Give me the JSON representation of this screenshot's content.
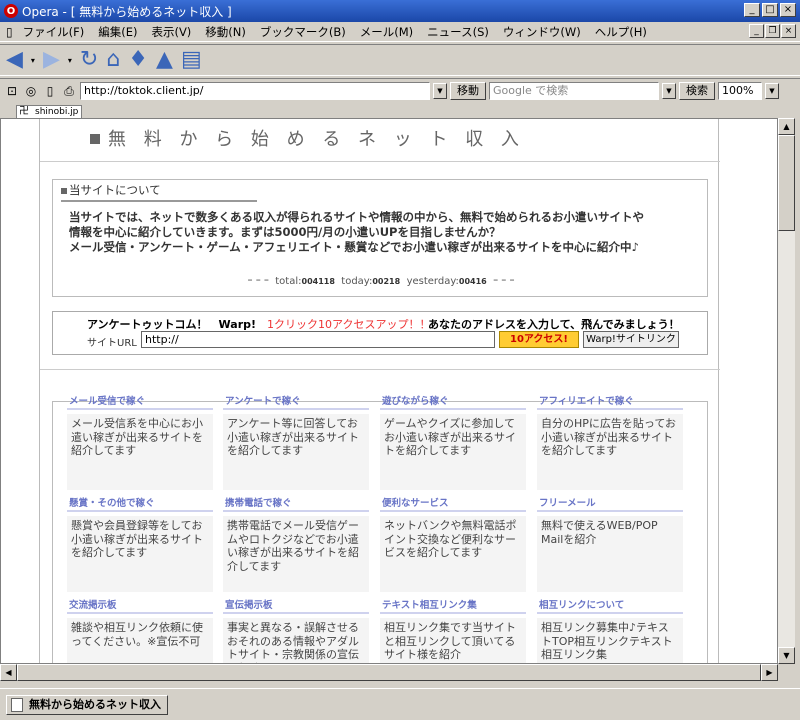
{
  "window": {
    "title": "Opera - [ 無料から始めるネット収入 ]",
    "app_icon": "O",
    "min": "_",
    "max": "□",
    "close": "×"
  },
  "menu": [
    "ファイル(F)",
    "編集(E)",
    "表示(V)",
    "移動(N)",
    "ブックマーク(B)",
    "メール(M)",
    "ニュース(S)",
    "ウィンドウ(W)",
    "ヘルプ(H)"
  ],
  "mdi": {
    "min": "_",
    "restore": "❐",
    "close": "×"
  },
  "toolbar": {
    "back": "◀",
    "forward": "▶",
    "reload": "↻",
    "home": "⌂",
    "hotlist": "♦",
    "print": "▲",
    "notes": "▤"
  },
  "address": {
    "url": "http://toktok.client.jp/",
    "go_label": "移動",
    "search_placeholder": "Google で検索",
    "search_label": "検索",
    "zoom": "100%"
  },
  "tab": {
    "label": "shinobi.jp",
    "icon": "卍"
  },
  "page": {
    "title": "無 料 か ら 始 め る ネ ッ ト 収 入",
    "about": {
      "heading": "当サイトについて",
      "lines": [
        "当サイトでは、ネットで数多くある収入が得られるサイトや情報の中から、無料で始められるお小遣いサイトや",
        "情報を中心に紹介していきます。まずは5000円/月の小遣いUPを目指しませんか？",
        "メール受信・アンケート・ゲーム・アフェリエイト・懸賞などでお小遣い稼ぎが出来るサイトを中心に紹介中♪"
      ],
      "counter": {
        "total_label": "total:",
        "total": "004118",
        "today_label": "today:",
        "today": "00218",
        "yesterday_label": "yesterday:",
        "yesterday": "00416"
      }
    },
    "warp": {
      "title": "アンケートゥットコム！　Warp!",
      "emphasis": "1クリック10アクセスアップ！！",
      "message": "あなたのアドレスを入力して、飛んでみましょう！",
      "url_label": "サイトURL",
      "url_value": "http://",
      "go_button": "10アクセス!",
      "link_button": "Warp!サイトリンク"
    },
    "categories": [
      {
        "title": "メール受信で稼ぐ",
        "desc": "メール受信系を中心にお小遣い稼ぎが出来るサイトを紹介してます"
      },
      {
        "title": "アンケートで稼ぐ",
        "desc": "アンケート等に回答してお小遣い稼ぎが出来るサイトを紹介してます"
      },
      {
        "title": "遊びながら稼ぐ",
        "desc": "ゲームやクイズに参加してお小遣い稼ぎが出来るサイトを紹介してます"
      },
      {
        "title": "アフィリエイトで稼ぐ",
        "desc": "自分のHPに広告を貼ってお小遣い稼ぎが出来るサイトを紹介してます"
      },
      {
        "title": "懸賞・その他で稼ぐ",
        "desc": "懸賞や会員登録等をしてお小遣い稼ぎが出来るサイトを紹介してます"
      },
      {
        "title": "携帯電話で稼ぐ",
        "desc": "携帯電話でメール受信ゲームやロトクジなどでお小遣い稼ぎが出来るサイトを紹介してます"
      },
      {
        "title": "便利なサービス",
        "desc": "ネットバンクや無料電話ポイント交換など便利なサービスを紹介してます"
      },
      {
        "title": "フリーメール",
        "desc": "無料で使えるWEB/POP Mailを紹介"
      },
      {
        "title": "交流掲示板",
        "desc": "雑談や相互リンク依頼に使ってください。※宣伝不可"
      },
      {
        "title": "宣伝掲示板",
        "desc": "事実と異なる・誤解させるおそれのある情報やアダルトサイト・宗教関係の宣伝は削除します"
      },
      {
        "title": "テキスト相互リンク集",
        "desc": "相互リンク集です当サイトと相互リンクして頂いてるサイト様を紹介"
      },
      {
        "title": "相互リンクについて",
        "desc": "相互リンク募集中♪テキストTOP相互リンクテキスト相互リンク集"
      }
    ]
  },
  "status": {
    "tab_label": "無料から始めるネット収入"
  }
}
